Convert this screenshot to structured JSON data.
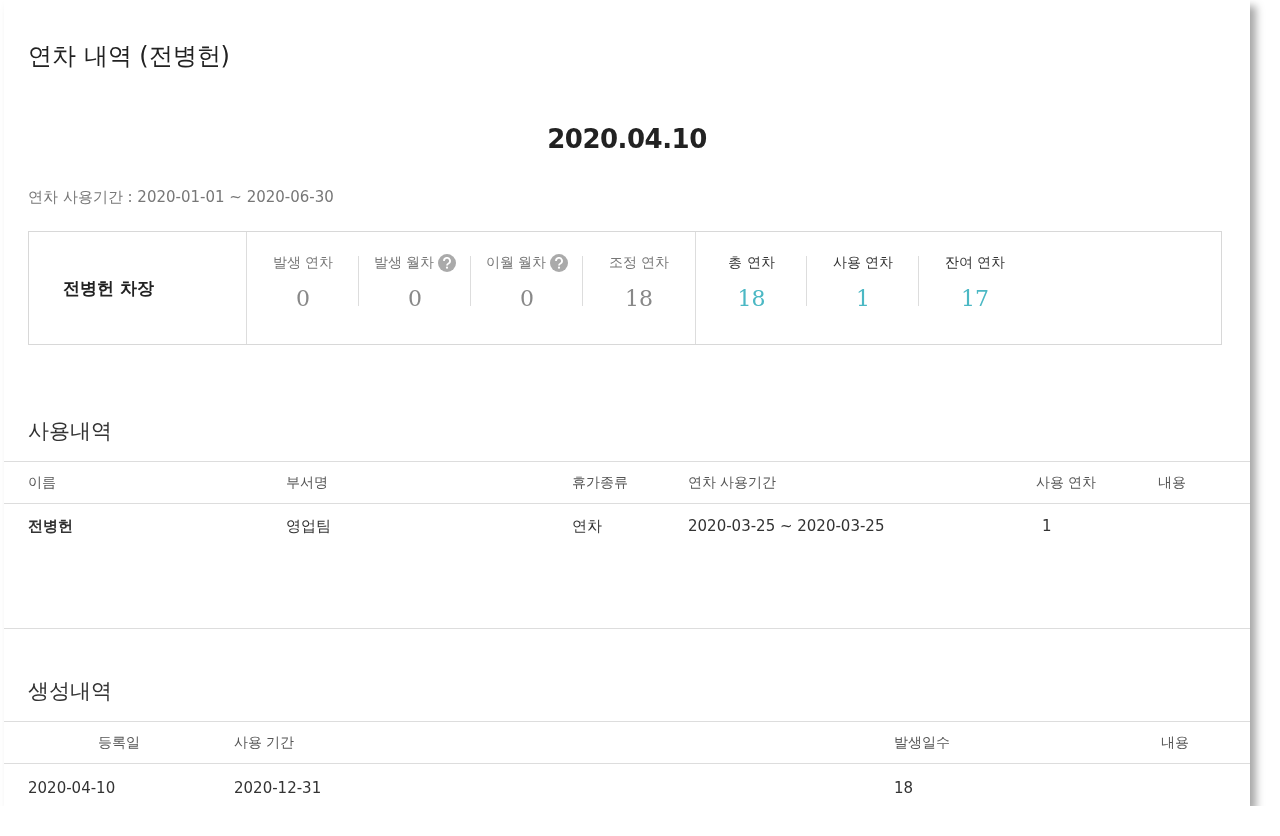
{
  "title": "연차 내역 (전병헌)",
  "date": "2020.04.10",
  "period": "연차 사용기간 : 2020-01-01 ~ 2020-06-30",
  "summary": {
    "name": "전병헌 차장",
    "stats": [
      {
        "label": "발생 연차",
        "value": "0",
        "kind": "base",
        "help": false
      },
      {
        "label": "발생 월차",
        "value": "0",
        "kind": "base",
        "help": true
      },
      {
        "label": "이월 월차",
        "value": "0",
        "kind": "base",
        "help": true
      },
      {
        "label": "조정 연차",
        "value": "18",
        "kind": "base",
        "help": false
      },
      {
        "label": "총 연차",
        "value": "18",
        "kind": "total",
        "help": false
      },
      {
        "label": "사용 연차",
        "value": "1",
        "kind": "total",
        "help": false
      },
      {
        "label": "잔여 연차",
        "value": "17",
        "kind": "total",
        "help": false
      }
    ]
  },
  "usage": {
    "title": "사용내역",
    "columns": [
      "이름",
      "부서명",
      "휴가종류",
      "연차 사용기간",
      "사용 연차",
      "내용"
    ],
    "rows": [
      [
        "전병헌",
        "영업팀",
        "연차",
        "2020-03-25 ~ 2020-03-25",
        "1",
        ""
      ]
    ]
  },
  "created": {
    "title": "생성내역",
    "columns": [
      "등록일",
      "사용 기간",
      "발생일수",
      "내용"
    ],
    "rows": [
      [
        "2020-04-10",
        "2020-12-31",
        "18",
        ""
      ]
    ]
  }
}
